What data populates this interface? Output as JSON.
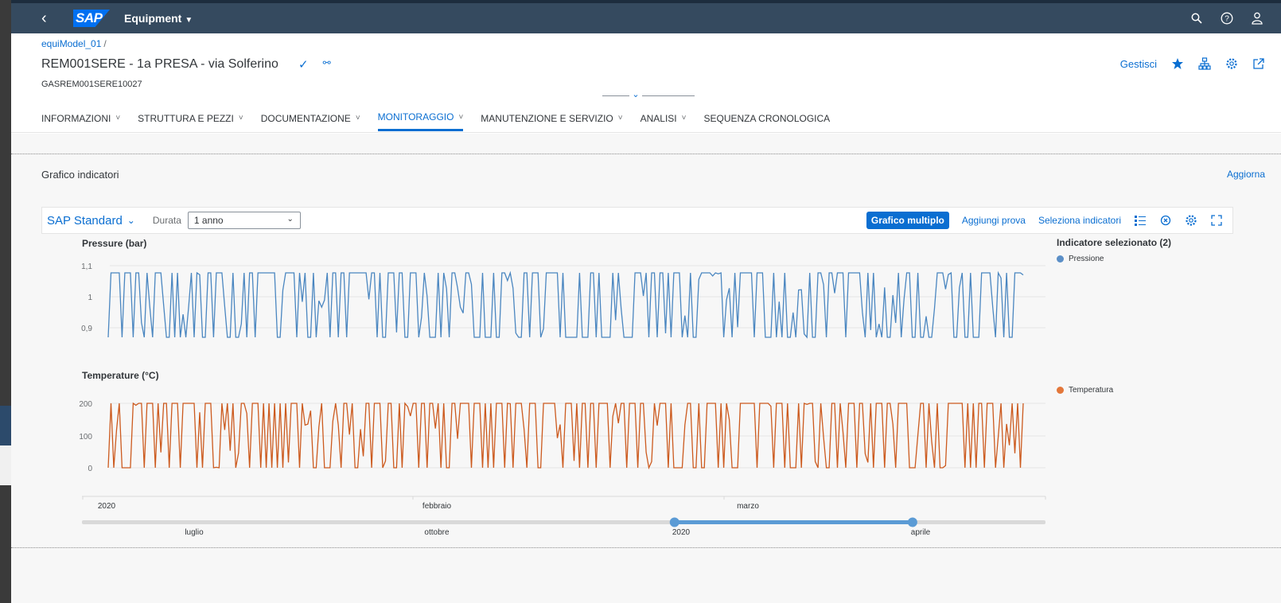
{
  "shell": {
    "app_title": "Equipment",
    "logo_text": "SAP"
  },
  "header": {
    "breadcrumb": "equiModel_01",
    "breadcrumb_sep": "/",
    "title": "REM001SERE - 1a PRESA - via Solferino",
    "subtitle": "GASREM001SERE10027",
    "manage_label": "Gestisci"
  },
  "tabs": [
    {
      "label": "INFORMAZIONI",
      "has_menu": true
    },
    {
      "label": "STRUTTURA E PEZZI",
      "has_menu": true
    },
    {
      "label": "DOCUMENTAZIONE",
      "has_menu": true
    },
    {
      "label": "MONITORAGGIO",
      "has_menu": true,
      "active": true
    },
    {
      "label": "MANUTENZIONE E SERVIZIO",
      "has_menu": true
    },
    {
      "label": "ANALISI",
      "has_menu": true
    },
    {
      "label": "SEQUENZA CRONOLOGICA",
      "has_menu": false
    }
  ],
  "section": {
    "title": "Grafico indicatori",
    "refresh_label": "Aggiorna"
  },
  "toolbar": {
    "variant": "SAP Standard",
    "duration_label": "Durata",
    "duration_value": "1 anno",
    "multi_chart_label": "Grafico multiplo",
    "add_test_label": "Aggiungi prova",
    "select_indicators_label": "Seleziona indicatori"
  },
  "legend": {
    "title": "Indicatore selezionato (2)",
    "items": [
      {
        "name": "Pressione",
        "color": "#5b8fc7"
      },
      {
        "name": "Temperatura",
        "color": "#e3773a"
      }
    ]
  },
  "colors": {
    "accent": "#0a6ed1",
    "shell": "#354a5f",
    "pressure": "#4a86c0",
    "temperature": "#cc5a1e"
  },
  "chart_data": [
    {
      "type": "line",
      "title": "Pressure (bar)",
      "series": [
        {
          "name": "Pressione",
          "note": "oscillating between ~0.87 and ~1.08 throughout period"
        }
      ],
      "yticks": [
        "1,1",
        "1",
        "0,9"
      ],
      "ylim": [
        0.87,
        1.1
      ],
      "ytick_values": [
        1.1,
        1.0,
        0.9
      ],
      "value_range": [
        0.87,
        1.08
      ]
    },
    {
      "type": "line",
      "title": "Temperature (°C)",
      "series": [
        {
          "name": "Temperatura",
          "note": "oscillating between 0 and 200 throughout period"
        }
      ],
      "yticks": [
        "200",
        "100",
        "0"
      ],
      "ytick_values": [
        200,
        100,
        0
      ],
      "ylim": [
        0,
        200
      ],
      "value_range": [
        0,
        200
      ]
    }
  ],
  "time_axis": {
    "ticks": [
      "2020",
      "febbraio",
      "marzo"
    ]
  },
  "range_slider": {
    "labels": [
      "luglio",
      "ottobre",
      "2020",
      "aprile"
    ],
    "selected_start_fraction": 0.615,
    "selected_end_fraction": 0.862
  }
}
